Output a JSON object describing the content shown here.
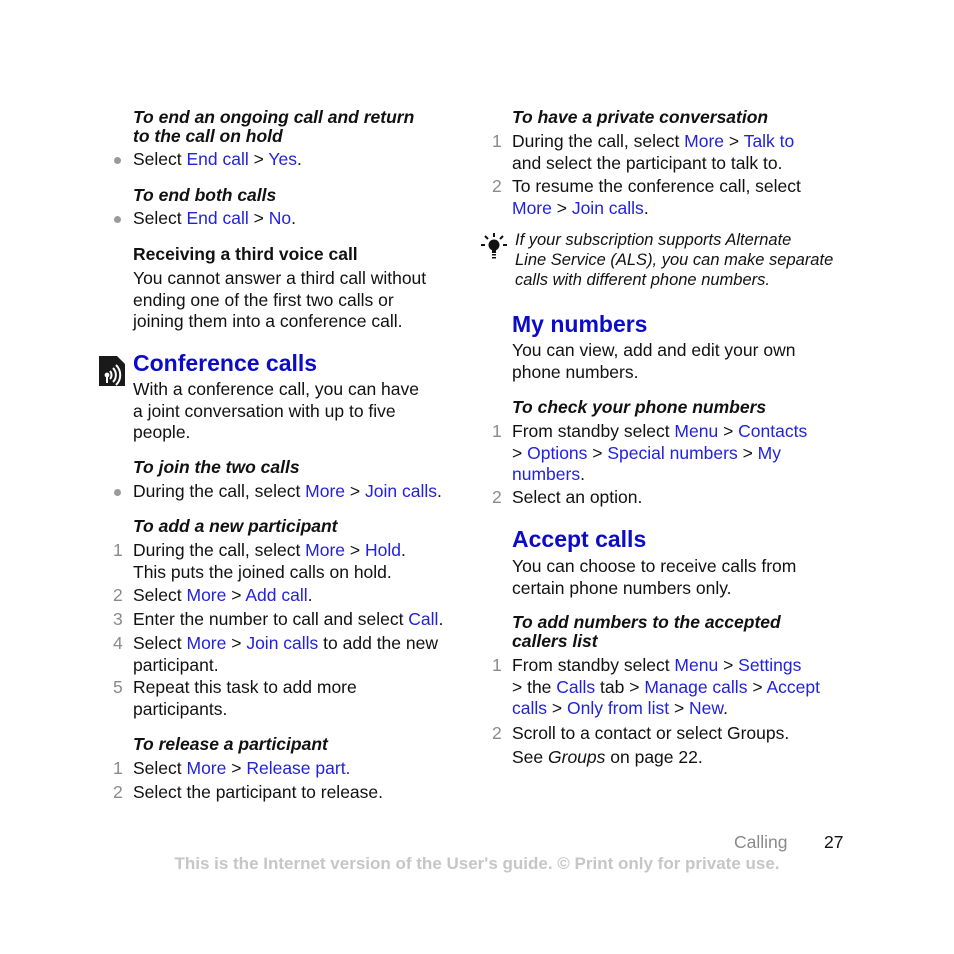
{
  "colors": {
    "heading": "#0b0bc8",
    "link": "#2222dd",
    "step_number": "#8a8a8a",
    "notice": "#c6c6c6"
  },
  "left": {
    "end_ongoing": {
      "title_line1": "To end an ongoing call and return",
      "title_line2": "to the call on hold",
      "bullet": {
        "pre": "Select ",
        "link1": "End call",
        "sep": " > ",
        "link2": "Yes",
        "post": "."
      }
    },
    "end_both": {
      "title": "To end both calls",
      "bullet": {
        "pre": "Select ",
        "link1": "End call",
        "sep": " > ",
        "link2": "No",
        "post": "."
      }
    },
    "third_call": {
      "heading": "Receiving a third voice call",
      "lines": [
        "You cannot answer a third call without",
        "ending one of the first two calls or",
        "joining them into a conference call."
      ]
    },
    "conference": {
      "icon": "network-service-icon",
      "heading": "Conference calls",
      "lines": [
        "With a conference call, you can have",
        "a joint conversation with up to five",
        "people."
      ]
    },
    "join_two": {
      "title": "To join the two calls",
      "bullet": {
        "pre": "During the call, select ",
        "link1": "More",
        "sep": " > ",
        "link2": "Join calls",
        "post": "."
      }
    },
    "add_participant": {
      "title": "To add a new participant",
      "steps": [
        {
          "num": "1",
          "pre": "During the call, select ",
          "link1": "More",
          "sep": " > ",
          "link2": "Hold",
          "post": ".",
          "line2": "This puts the joined calls on hold."
        },
        {
          "num": "2",
          "pre": "Select ",
          "link1": "More",
          "sep": " > ",
          "link2": "Add call",
          "post": "."
        },
        {
          "num": "3",
          "pre": "Enter the number to call and select ",
          "link1": "Call",
          "post": "."
        },
        {
          "num": "4",
          "pre": "Select ",
          "link1": "More",
          "sep": " > ",
          "link2": "Join calls",
          "post": " to add the new",
          "line2": "participant."
        },
        {
          "num": "5",
          "pre": "Repeat this task to add more",
          "line2": "participants."
        }
      ]
    },
    "release": {
      "title": "To release a participant",
      "steps": [
        {
          "num": "1",
          "pre": "Select ",
          "link1": "More",
          "sep": " > ",
          "link2": "Release part."
        },
        {
          "num": "2",
          "pre": "Select the participant to release."
        }
      ]
    }
  },
  "right": {
    "private": {
      "title": "To have a private conversation",
      "steps": [
        {
          "num": "1",
          "pre": "During the call, select ",
          "link1": "More",
          "sep": " > ",
          "link2": "Talk to",
          "line2": "and select the participant to talk to."
        },
        {
          "num": "2",
          "pre": "To resume the conference call, select",
          "l2_link1": "More",
          "l2_sep": " > ",
          "l2_link2": "Join calls",
          "l2_post": "."
        }
      ]
    },
    "tip": {
      "icon": "tip-lightbulb-icon",
      "lines": [
        "If your subscription supports Alternate",
        "Line Service (ALS), you can make separate",
        "calls with different phone numbers."
      ]
    },
    "my_numbers": {
      "heading": "My numbers",
      "lines": [
        "You can view, add and edit your own",
        "phone numbers."
      ],
      "title": "To check your phone numbers",
      "steps": [
        {
          "num": "1",
          "pre": "From standby select ",
          "link1": "Menu",
          "sep": " > ",
          "link2": "Contacts",
          "l2_sep0": "> ",
          "l2_link1": "Options",
          "l2_sep1": " > ",
          "l2_link2": "Special numbers",
          "l2_sep2": " > ",
          "l2_link3": "My",
          "l3_link1": "numbers",
          "l3_post": "."
        },
        {
          "num": "2",
          "pre": "Select an option."
        }
      ]
    },
    "accept_calls": {
      "heading": "Accept calls",
      "lines": [
        "You can choose to receive calls from",
        "certain phone numbers only."
      ],
      "title_line1": "To add numbers to the accepted",
      "title_line2": "callers list",
      "steps": [
        {
          "num": "1",
          "pre": "From standby select ",
          "link1": "Menu",
          "sep": " > ",
          "link2": "Settings",
          "l2_pre": "> the ",
          "l2_link1": "Calls",
          "l2_mid": " tab > ",
          "l2_link2": "Manage calls",
          "l2_sep": " > ",
          "l2_link3": "Accept",
          "l3_link1": "calls",
          "l3_sep1": " > ",
          "l3_link2": "Only from list",
          "l3_sep2": " > ",
          "l3_link3": "New",
          "l3_post": "."
        },
        {
          "num": "2",
          "pre": "Scroll to a contact or select Groups.",
          "l2_pre": "See ",
          "l2_italic": "Groups",
          "l2_post": " on page 22."
        }
      ]
    }
  },
  "footer": {
    "section": "Calling",
    "page": "27",
    "notice": "This is the Internet version of the User's guide. © Print only for private use."
  }
}
